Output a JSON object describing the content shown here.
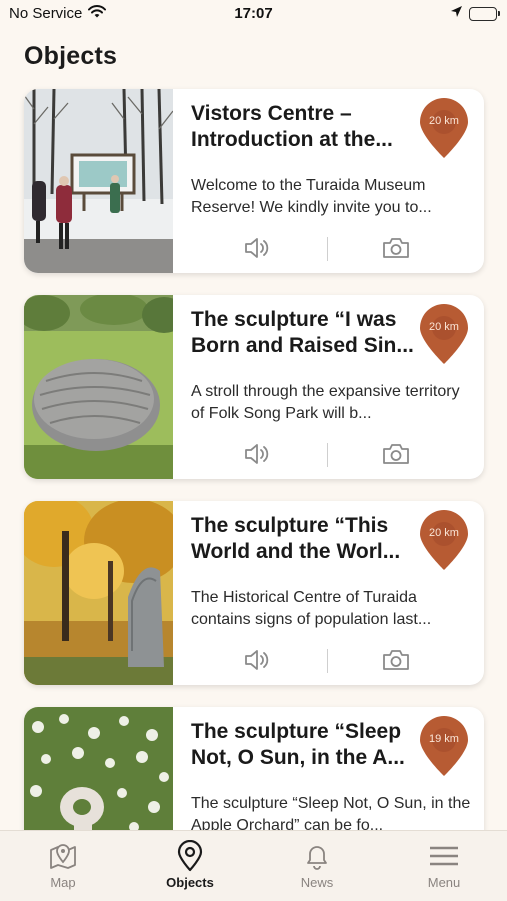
{
  "status_bar": {
    "carrier": "No Service",
    "time": "17:07",
    "icons": [
      "wifi-icon",
      "location-arrow-icon",
      "battery-charging-icon"
    ],
    "battery_color": "#36c75a"
  },
  "page": {
    "title": "Objects"
  },
  "accent_color": "#b75b33",
  "objects": [
    {
      "title": "Vistors Centre – Introduction at the...",
      "distance": "20 km",
      "description": "Welcome to the Turaida Museum Reserve! We kindly invite you to...",
      "image": "winter-visitors-board-photo"
    },
    {
      "title": "The sculpture “I was Born and Raised Sin...",
      "distance": "20 km",
      "description": "A stroll through the expansive territory of Folk Song Park will b...",
      "image": "stone-sculpture-park-photo"
    },
    {
      "title": "The sculpture “This World and the Worl...",
      "distance": "20 km",
      "description": "The Historical Centre of Turaida contains signs of population last...",
      "image": "autumn-sculpture-photo"
    },
    {
      "title": "The sculpture “Sleep Not, O Sun, in the A...",
      "distance": "19 km",
      "description": "The sculpture “Sleep Not, O Sun, in the Apple Orchard” can be fo...",
      "image": "apple-orchard-sculpture-photo"
    }
  ],
  "card_actions": {
    "icons": [
      "speaker-icon",
      "camera-icon"
    ]
  },
  "tab_bar": {
    "active": "Objects",
    "tabs": [
      {
        "label": "Map",
        "icon": "map-pin-icon"
      },
      {
        "label": "Objects",
        "icon": "location-pin-icon"
      },
      {
        "label": "News",
        "icon": "bell-icon"
      },
      {
        "label": "Menu",
        "icon": "hamburger-menu-icon"
      }
    ]
  }
}
